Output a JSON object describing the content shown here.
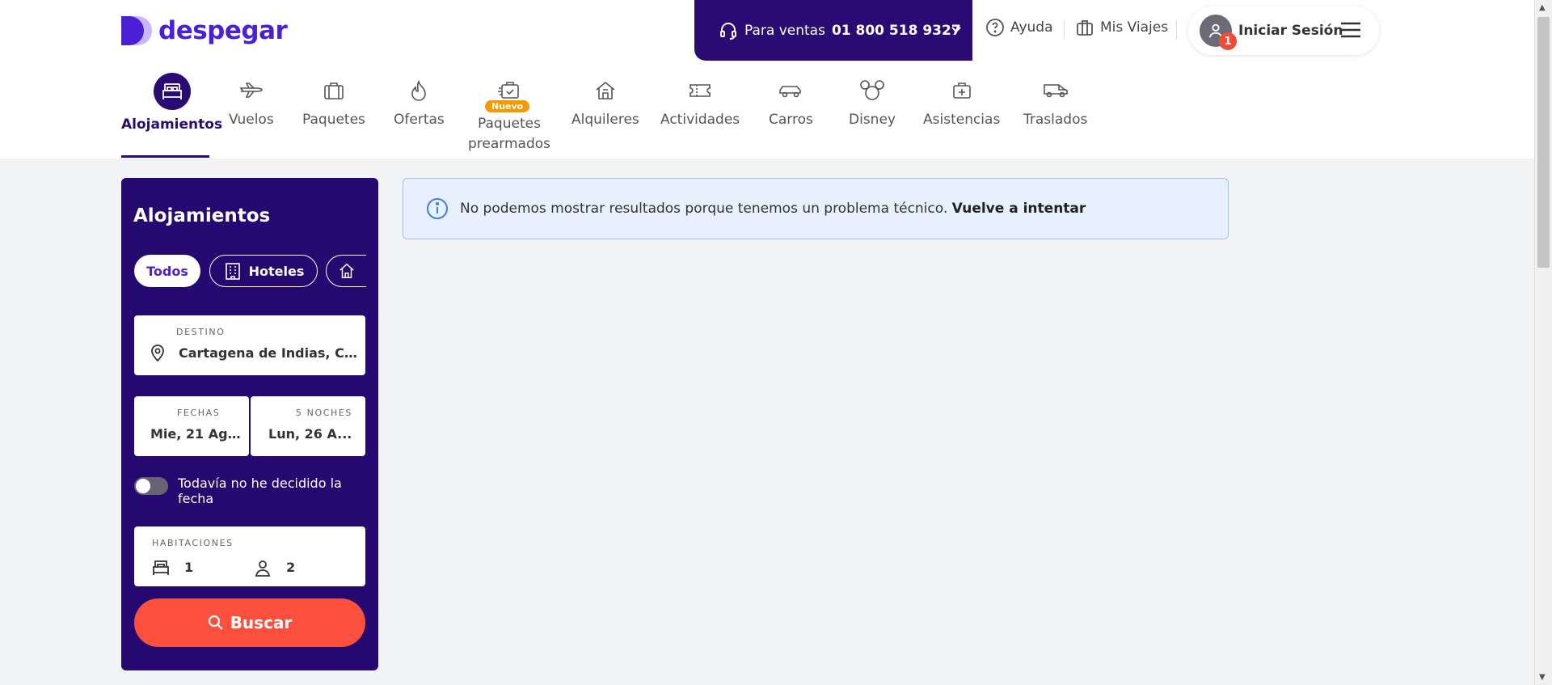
{
  "brand": {
    "name": "despegar"
  },
  "header": {
    "sales_prefix": "Para ventas",
    "sales_phone": "01 800 518 9327",
    "help": "Ayuda",
    "trips": "Mis Viajes",
    "login": "Iniciar Sesión",
    "notification_count": "1"
  },
  "nav": {
    "items": [
      {
        "label": "Alojamientos",
        "icon": "bed-icon"
      },
      {
        "label": "Vuelos",
        "icon": "plane-icon"
      },
      {
        "label": "Paquetes",
        "icon": "suitcase-icon"
      },
      {
        "label": "Ofertas",
        "icon": "flame-icon"
      },
      {
        "label": "Paquetes prearmados",
        "icon": "package-suitcase-icon"
      },
      {
        "label": "Alquileres",
        "icon": "house-icon"
      },
      {
        "label": "Actividades",
        "icon": "ticket-icon"
      },
      {
        "label": "Carros",
        "icon": "car-icon"
      },
      {
        "label": "Disney",
        "icon": "mickey-icon"
      },
      {
        "label": "Asistencias",
        "icon": "medkit-icon"
      },
      {
        "label": "Traslados",
        "icon": "van-icon"
      }
    ],
    "new_badge": "Nuevo",
    "active": "Alojamientos"
  },
  "search": {
    "title": "Alojamientos",
    "filters": [
      "Todos",
      "Hoteles"
    ],
    "selected_filter": "Todos",
    "destination_label": "DESTINO",
    "destination_value": "Cartagena de Indias, Co...",
    "dates_label": "FECHAS",
    "nights_label": "5 NOCHES",
    "checkin": "Mie, 21 Ag...",
    "checkout": "Lun, 26 A...",
    "undecided_label": "Todavía no he decidido la fecha",
    "rooms_label": "HABITACIONES",
    "rooms": "1",
    "guests": "2",
    "search_button": "Buscar"
  },
  "alert": {
    "message": "No podemos mostrar resultados porque tenemos un problema técnico.",
    "action": "Vuelve a intentar"
  },
  "colors": {
    "brand_purple": "#4a1fd6",
    "dark_purple": "#250870",
    "search_button": "#fc503f",
    "new_badge": "#f39a00",
    "alert_bg": "#e7f0fc"
  }
}
